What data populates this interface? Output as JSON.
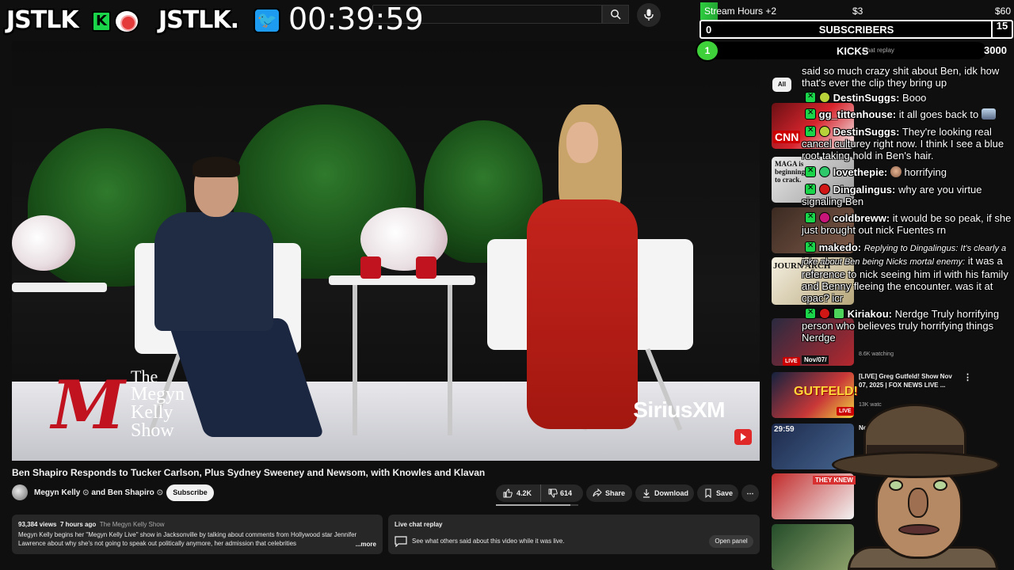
{
  "overlay": {
    "logo_left": "JSTLK",
    "logo_right": "JSTLK.",
    "kick_badge": "K",
    "timer": "00:39:59"
  },
  "goals": {
    "stream_hours_label": "Stream Hours +2",
    "stream_hours_mid": "$3",
    "stream_hours_end": "$60",
    "subs_current": "0",
    "subs_label": "SUBSCRIBERS",
    "subs_target": "15",
    "kicks_current": "1",
    "kicks_label": "KICKS",
    "kicks_sub": "Chat replay",
    "kicks_target": "3000"
  },
  "video": {
    "show_the": "The",
    "show_name_1": "Megyn",
    "show_name_2": "Kelly",
    "show_name_3": "Show",
    "sponsor": "SiriusXM",
    "title": "Ben Shapiro Responds to Tucker Carlson, Plus Sydney Sweeney and Newsom, with Knowles and Klavan",
    "channel": "Megyn Kelly",
    "and_text": "and",
    "collab": "Ben Shapiro",
    "subscribe_label": "Subscribe",
    "likes": "4.2K",
    "dislikes": "614",
    "like_ratio": 0.9,
    "share_label": "Share",
    "download_label": "Download",
    "save_label": "Save",
    "more_label": "⋯"
  },
  "description": {
    "views": "93,384 views",
    "age": "7 hours ago",
    "tag": "The Megyn Kelly Show",
    "text": "Megyn Kelly begins her \"Megyn Kelly Live\" show in Jacksonville by talking about comments from Hollywood star Jennifer Lawrence about why she's not going to speak out politically anymore, her admission that celebrities",
    "more": "...more"
  },
  "live_chat_replay": {
    "title": "Live chat replay",
    "text": "See what others said about this video while it was live.",
    "open_panel": "Open panel"
  },
  "recommended": {
    "chip_all": "All",
    "cnn": "CNN",
    "maga": "MAGA is beginning to crack.",
    "journal": "JOURN ARCH",
    "live": "LIVE",
    "date_badge": "Nov/07/",
    "watching": "8.6K watching",
    "item_title": "[LIVE] Greg Gutfeld! Show Nov 07, 2025 | FOX NEWS LIVE ...",
    "item_sub": "13K watc",
    "gutfeld": "GUTFELD!",
    "timecode": "29:59",
    "they_knew": "THEY KNEW",
    "partial": "No o"
  },
  "chat": [
    {
      "user": "",
      "text": "said so much crazy shit about Ben, idk how that's ever the clip they bring up"
    },
    {
      "user": "DestinSuggs:",
      "text": "Booo"
    },
    {
      "user": "gg_tittenhouse:",
      "text": "it all goes back to"
    },
    {
      "user": "DestinSuggs:",
      "text": "They're looking real cancel culturey right now. I think I see a blue root taking hold in Ben's hair."
    },
    {
      "user": "lovethepie:",
      "text": "horrifying"
    },
    {
      "user": "Dingalingus:",
      "text": "why are you virtue signaling Ben"
    },
    {
      "user": "coldbreww:",
      "text": "it would be so peak, if she just brought out nick Fuentes rn"
    },
    {
      "user": "makedo:",
      "reply": "Replying to Dingalingus: It's clearly a joke about Ben being Nicks mortal enemy:",
      "text": "it was a reference to nick seeing him irl with his family and Benny fleeing the encounter. was it at cpac? icr"
    },
    {
      "user": "Kiriakou:",
      "text": "Nerdge Truly horrifying person who believes truly horrifying things Nerdge"
    }
  ],
  "colors": {
    "youtube_bg": "#0f0f0f",
    "kick_green": "#1ad54a",
    "megyn_red": "#c1121f",
    "live_red": "#cc0000"
  }
}
